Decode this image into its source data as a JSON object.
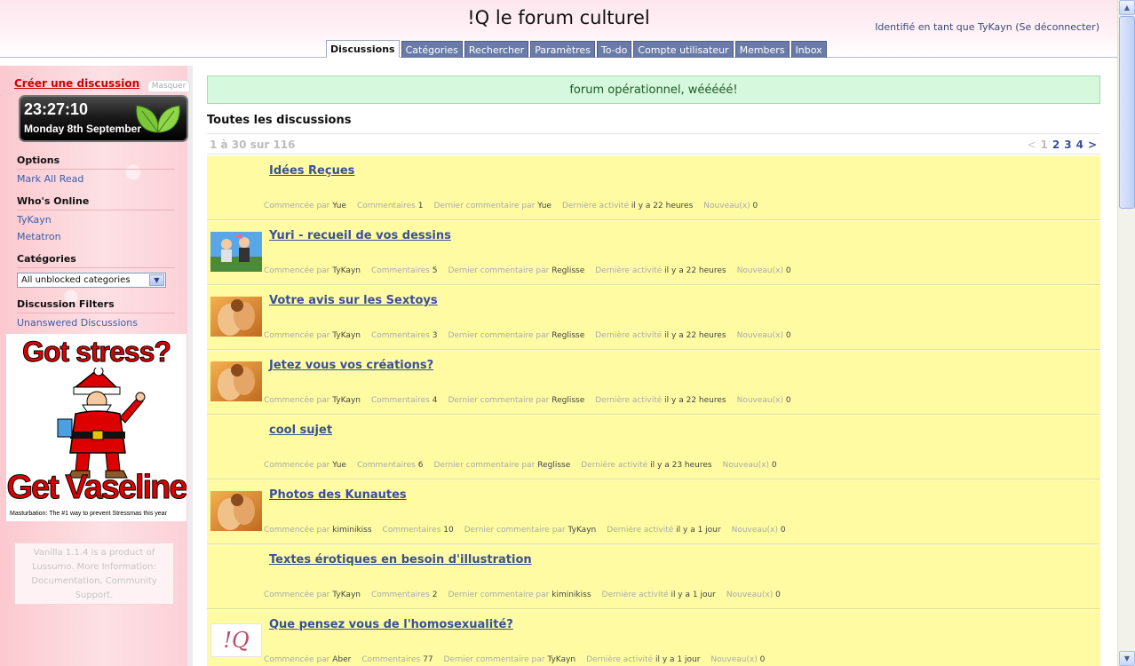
{
  "header": {
    "title": "!Q le forum culturel",
    "user_prefix": "Identifié en tant que TyKayn",
    "logout": "(Se déconnecter)"
  },
  "tabs": [
    {
      "label": "Discussions",
      "active": true
    },
    {
      "label": "Catégories"
    },
    {
      "label": "Rechercher"
    },
    {
      "label": "Paramètres"
    },
    {
      "label": "To-do"
    },
    {
      "label": "Compte utilisateur"
    },
    {
      "label": "Members"
    },
    {
      "label": "Inbox"
    }
  ],
  "sidebar": {
    "create": "Créer une discussion",
    "hide": "Masquer",
    "clock": {
      "time": "23:27:10",
      "date": "Monday 8th September"
    },
    "options_heading": "Options",
    "mark_all_read": "Mark All Read",
    "online_heading": "Who's Online",
    "online_users": [
      "TyKayn",
      "Metatron"
    ],
    "categories_heading": "Catégories",
    "category_selected": "All unblocked categories",
    "filters_heading": "Discussion Filters",
    "unanswered": "Unanswered Discussions",
    "ad": {
      "top": "Got stress?",
      "bottom": "Get Vaseline",
      "caption": "Masturbation: The #1 way to prevent Stressmas this year"
    },
    "footer": [
      "Vanilla 1.1.4 is a product of",
      "Lussumo. More Information:",
      "Documentation, Community",
      "Support."
    ]
  },
  "main": {
    "notice": "forum opérationnel, wééééé!",
    "list_title": "Toutes les discussions",
    "range": "1 à 30 sur 116",
    "pager": {
      "prev": "<",
      "current": "1",
      "pages": [
        "2",
        "3",
        "4"
      ],
      "next": ">"
    },
    "labels": {
      "started": "Commencée par",
      "comments": "Commentaires",
      "last": "Dernier commentaire par",
      "activity": "Dernière activité",
      "new": "Nouveau(x)"
    }
  },
  "discussions": [
    {
      "title": "Idées Reçues",
      "avatar": "none",
      "author": "Yue",
      "comments": "1",
      "last": "Yue",
      "activity": "il y a 22 heures",
      "new": "0"
    },
    {
      "title": "Yuri - recueil de vos dessins",
      "avatar": "anime",
      "author": "TyKayn",
      "comments": "5",
      "last": "Reglisse",
      "activity": "il y a 22 heures",
      "new": "0"
    },
    {
      "title": "Votre avis sur les Sextoys",
      "avatar": "photo",
      "author": "TyKayn",
      "comments": "3",
      "last": "Reglisse",
      "activity": "il y a 22 heures",
      "new": "0"
    },
    {
      "title": "Jetez vous vos créations?",
      "avatar": "photo",
      "author": "TyKayn",
      "comments": "4",
      "last": "Reglisse",
      "activity": "il y a 22 heures",
      "new": "0"
    },
    {
      "title": "cool sujet",
      "avatar": "none",
      "author": "Yue",
      "comments": "6",
      "last": "Reglisse",
      "activity": "il y a 23 heures",
      "new": "0"
    },
    {
      "title": "Photos des Kunautes",
      "avatar": "photo",
      "author": "kiminikiss",
      "comments": "10",
      "last": "TyKayn",
      "activity": "il y a 1 jour",
      "new": "0"
    },
    {
      "title": "Textes érotiques en besoin d'illustration",
      "avatar": "none",
      "author": "TyKayn",
      "comments": "2",
      "last": "kiminikiss",
      "activity": "il y a 1 jour",
      "new": "0"
    },
    {
      "title": "Que pensez vous de l'homosexualité?",
      "avatar": "logo",
      "avatar_text": "!Q",
      "author": "Aber",
      "comments": "77",
      "last": "TyKayn",
      "activity": "il y a 1 jour",
      "new": "0"
    }
  ]
}
